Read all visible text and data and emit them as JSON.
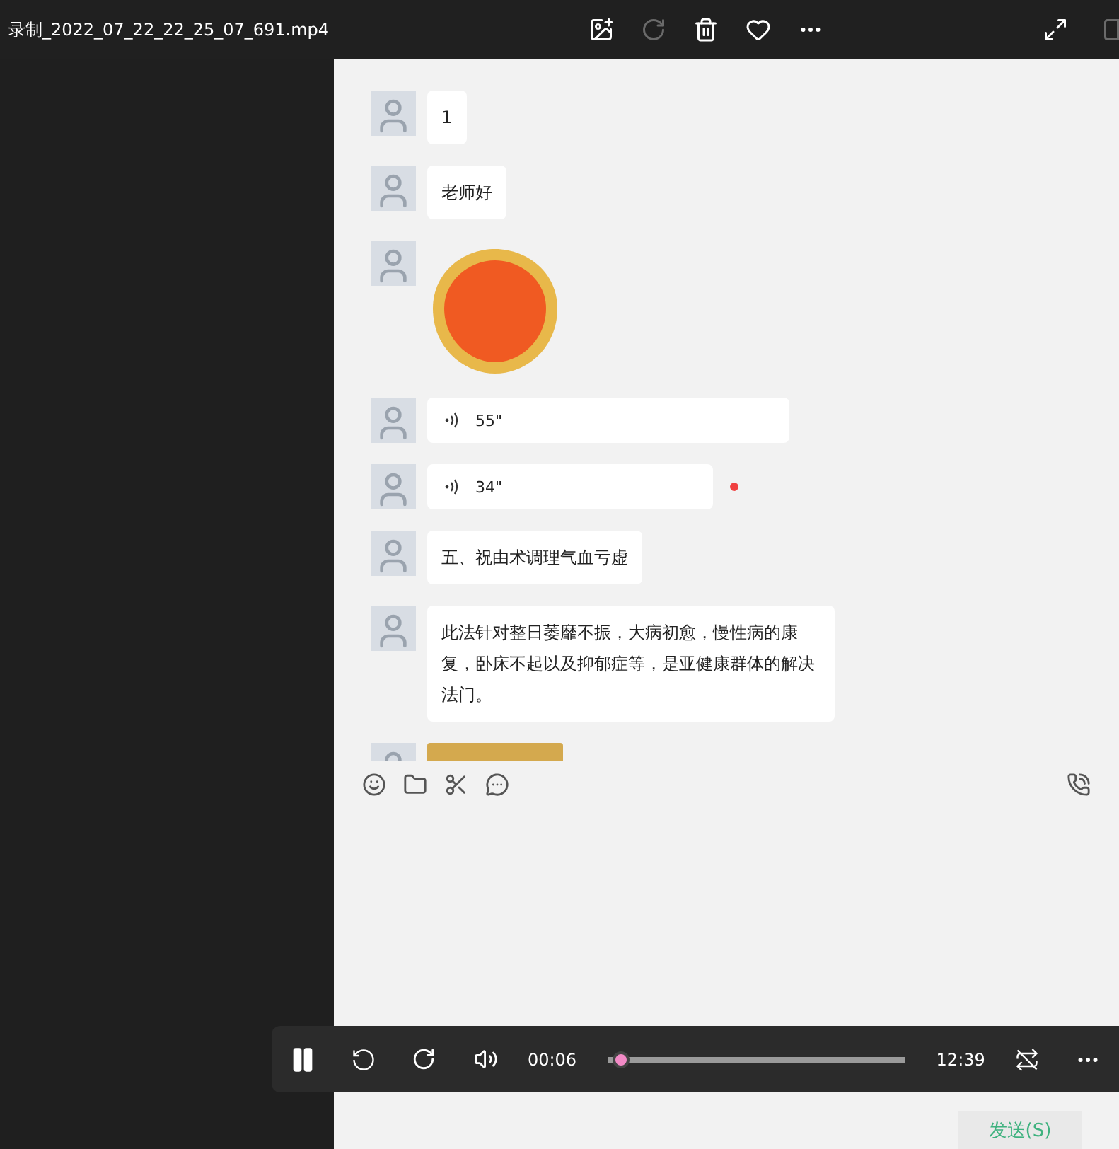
{
  "window": {
    "title": "录制_2022_07_22_22_25_07_691.mp4",
    "actions": [
      {
        "kind": "edit",
        "disabled": false
      },
      {
        "kind": "rotate",
        "disabled": true
      },
      {
        "kind": "delete",
        "disabled": false
      },
      {
        "kind": "favorite",
        "disabled": false
      },
      {
        "kind": "more",
        "disabled": false
      }
    ]
  },
  "chat": {
    "messages": [
      {
        "kind": "text",
        "text": "1"
      },
      {
        "kind": "text",
        "text": "老师好"
      },
      {
        "kind": "sticker"
      },
      {
        "kind": "voice",
        "text": "55\"",
        "unread": false
      },
      {
        "kind": "voice",
        "text": "34\"",
        "unread": true
      },
      {
        "kind": "text",
        "text": "五、祝由术调理气血亏虚"
      },
      {
        "kind": "text",
        "text": "此法针对整日萎靡不振，大病初愈，慢性病的康复，卧床不起以及抑郁症等，是亚健康群体的解决法门。"
      },
      {
        "kind": "image"
      }
    ],
    "send_button": "发送(S)"
  },
  "player": {
    "playing": true,
    "elapsed": "00:06",
    "duration": "12:39",
    "level": 0.02,
    "repeat": false
  }
}
